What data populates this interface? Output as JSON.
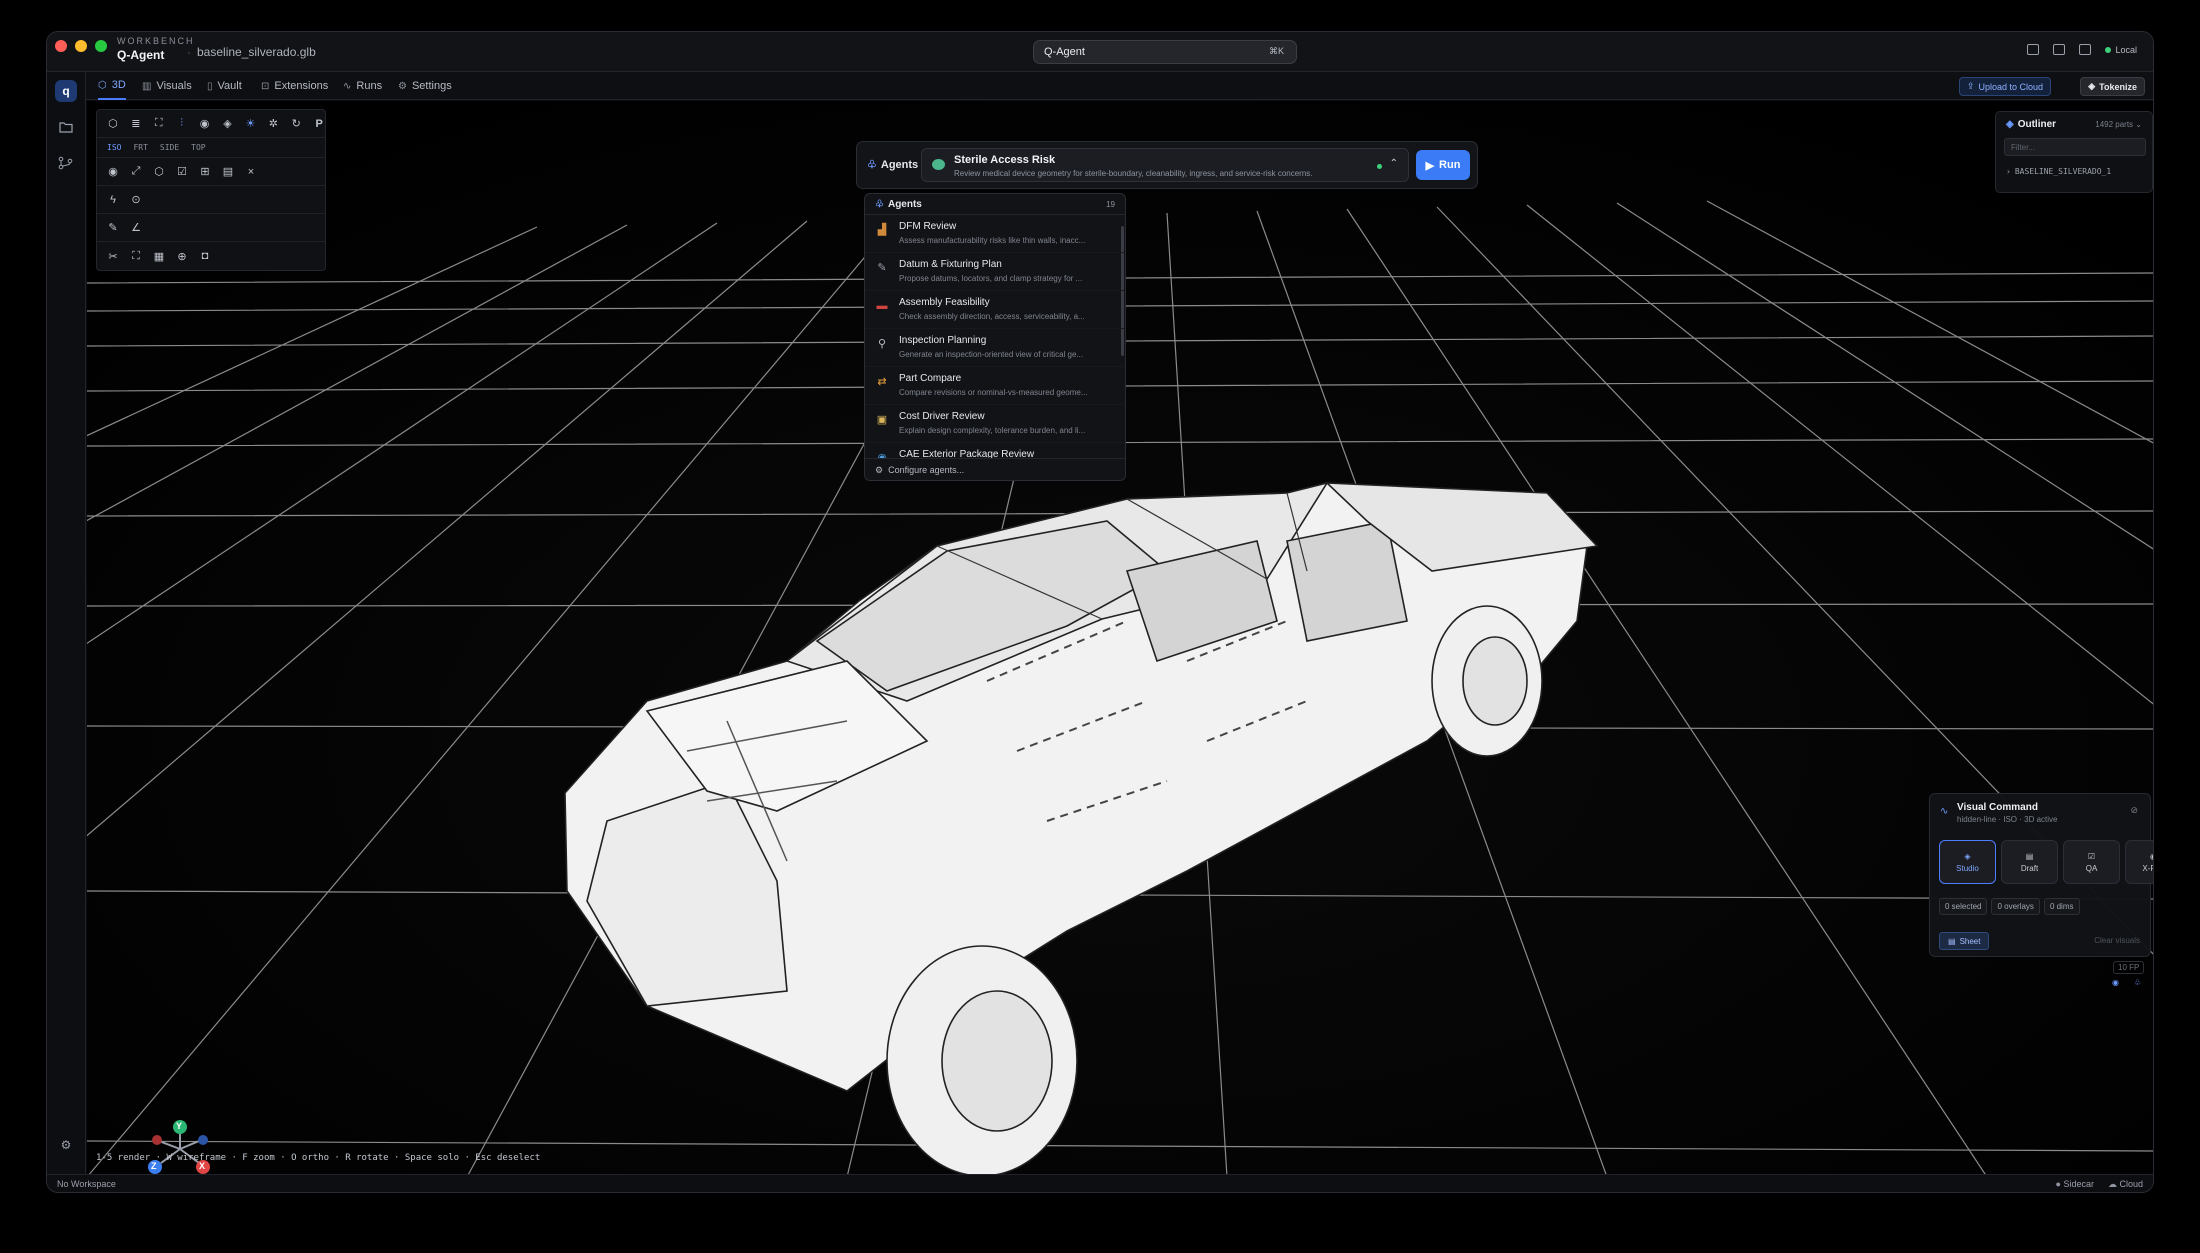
{
  "window": {
    "brand_small": "WORKBENCH",
    "brand": "Q-Agent",
    "filename": "baseline_silverado.glb",
    "search": "Q-Agent",
    "search_shortcut": "⌘K",
    "status_local": "Local"
  },
  "tabs": [
    {
      "label": "3D",
      "icon": "cube-icon"
    },
    {
      "label": "Visuals",
      "icon": "chart-icon"
    },
    {
      "label": "Vault",
      "icon": "book-icon"
    },
    {
      "label": "Extensions",
      "icon": "package-icon"
    },
    {
      "label": "Runs",
      "icon": "activity-icon"
    },
    {
      "label": "Settings",
      "icon": "gear-icon"
    }
  ],
  "actions": {
    "upload": "Upload to Cloud",
    "tokenize": "Tokenize"
  },
  "views": [
    "ISO",
    "FRT",
    "SIDE",
    "TOP"
  ],
  "agents_bar": {
    "label": "Agents",
    "selected_name": "Sterile Access Risk",
    "selected_desc": "Review medical device geometry for sterile-boundary, cleanability, ingress, and service-risk concerns.",
    "run": "Run"
  },
  "dropdown": {
    "title": "Agents",
    "count": "19",
    "items": [
      {
        "title": "DFM Review",
        "desc": "Assess manufacturability risks like thin walls, inacc...",
        "icon_color": "#d08a3a"
      },
      {
        "title": "Datum & Fixturing Plan",
        "desc": "Propose datums, locators, and clamp strategy for ...",
        "icon_color": "#9aa0aa"
      },
      {
        "title": "Assembly Feasibility",
        "desc": "Check assembly direction, access, serviceability, a...",
        "icon_color": "#d0453f"
      },
      {
        "title": "Inspection Planning",
        "desc": "Generate an inspection-oriented view of critical ge...",
        "icon_color": "#b8bec8"
      },
      {
        "title": "Part Compare",
        "desc": "Compare revisions or nominal-vs-measured geome...",
        "icon_color": "#e8a13a"
      },
      {
        "title": "Cost Driver Review",
        "desc": "Explain design complexity, tolerance burden, and li...",
        "icon_color": "#d9b45a"
      },
      {
        "title": "CAE Exterior Package Review",
        "desc": "",
        "icon_color": "#4b9ad8"
      }
    ],
    "configure": "Configure agents..."
  },
  "outliner": {
    "title": "Outliner",
    "parts": "1492 parts",
    "filter_placeholder": "Filter...",
    "node": "BASELINE_SILVERADO_1"
  },
  "visual_command": {
    "title": "Visual Command",
    "subtitle": "hidden-line · ISO · 3D active",
    "modes": [
      "Studio",
      "Draft",
      "QA",
      "X-Ray"
    ],
    "active_mode": "Studio",
    "chips": [
      "0 selected",
      "0 overlays",
      "0 dims"
    ],
    "sheet": "Sheet",
    "clear": "Clear visuals",
    "fps": "10 FP"
  },
  "axes": {
    "x": "X",
    "y": "Y",
    "z": "Z"
  },
  "shortcuts": "1-5 render · W wireframe · F zoom · O ortho · R rotate · Space solo · Esc deselect",
  "status": {
    "workspace": "No Workspace",
    "sidecar": "Sidecar",
    "cloud": "Cloud"
  },
  "colors": {
    "accent": "#3b7bf6",
    "active_tab": "#7fa6ff",
    "status_green": "#3fd07b"
  }
}
